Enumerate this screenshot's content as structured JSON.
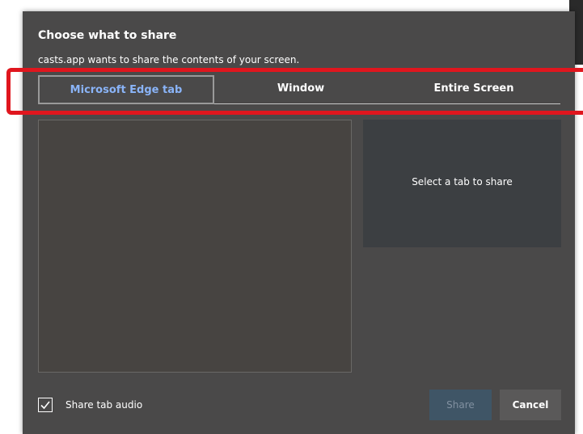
{
  "dialog": {
    "title": "Choose what to share",
    "subtitle": "casts.app wants to share the contents of your screen."
  },
  "tabs": [
    {
      "label": "Microsoft Edge tab",
      "selected": true
    },
    {
      "label": "Window",
      "selected": false
    },
    {
      "label": "Entire Screen",
      "selected": false
    }
  ],
  "preview": {
    "message": "Select a tab to share"
  },
  "audio": {
    "label": "Share tab audio",
    "checked": true
  },
  "buttons": {
    "share_label": "Share",
    "share_enabled": false,
    "cancel_label": "Cancel"
  },
  "colors": {
    "dialog_bg": "#4a4949",
    "selected_tab_text": "#8ab4f8",
    "highlight_outline": "#e0161e",
    "share_button_disabled": "#3f5566"
  },
  "icons": {
    "checkbox": "checkmark-icon"
  }
}
